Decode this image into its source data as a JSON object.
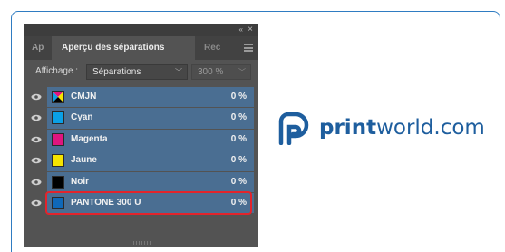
{
  "panel": {
    "tabs": [
      {
        "label": "Ap"
      },
      {
        "label": "Aperçu des séparations"
      },
      {
        "label": "Rec"
      }
    ],
    "view_label": "Affichage :",
    "view_value": "Séparations",
    "zoom_value": "300 %",
    "rows": [
      {
        "name": "CMJN",
        "value": "0 %",
        "swatch": "cmjn"
      },
      {
        "name": "Cyan",
        "value": "0 %",
        "swatch": "#0aa0e6"
      },
      {
        "name": "Magenta",
        "value": "0 %",
        "swatch": "#e0157f"
      },
      {
        "name": "Jaune",
        "value": "0 %",
        "swatch": "#f5e400"
      },
      {
        "name": "Noir",
        "value": "0 %",
        "swatch": "#000000"
      },
      {
        "name": "PANTONE 300 U",
        "value": "0 %",
        "swatch": "#0f68b8"
      }
    ]
  },
  "brand": {
    "name_print": "print",
    "name_rest": "world.com",
    "color": "#1e5e9e"
  },
  "colors": {
    "card_border": "#2f7cc2",
    "highlight": "#e3242b",
    "row_bg": "#4a6e92"
  }
}
